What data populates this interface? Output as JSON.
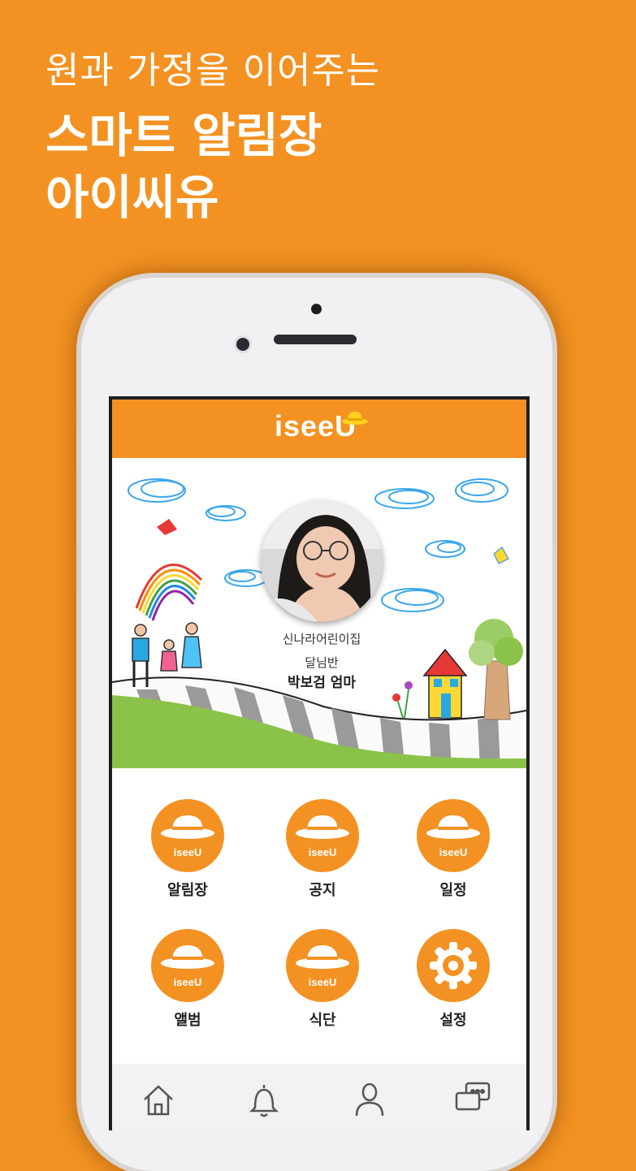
{
  "headline": {
    "line1": "원과 가정을 이어주는",
    "line2": "스마트 알림장",
    "line3": "아이씨유"
  },
  "app": {
    "logo_text": "iseeU",
    "brand_color": "#F39222"
  },
  "profile": {
    "school": "신나라어린이집",
    "class": "달님반",
    "user": "박보검 엄마"
  },
  "menu": [
    {
      "label": "알림장",
      "icon": "iseeu-hat-icon"
    },
    {
      "label": "공지",
      "icon": "iseeu-hat-icon"
    },
    {
      "label": "일정",
      "icon": "iseeu-hat-icon"
    },
    {
      "label": "앨범",
      "icon": "iseeu-hat-icon"
    },
    {
      "label": "식단",
      "icon": "iseeu-hat-icon"
    },
    {
      "label": "설정",
      "icon": "gear-icon"
    }
  ],
  "tabbar": [
    "home-icon",
    "bell-icon",
    "person-icon",
    "chat-icon"
  ]
}
